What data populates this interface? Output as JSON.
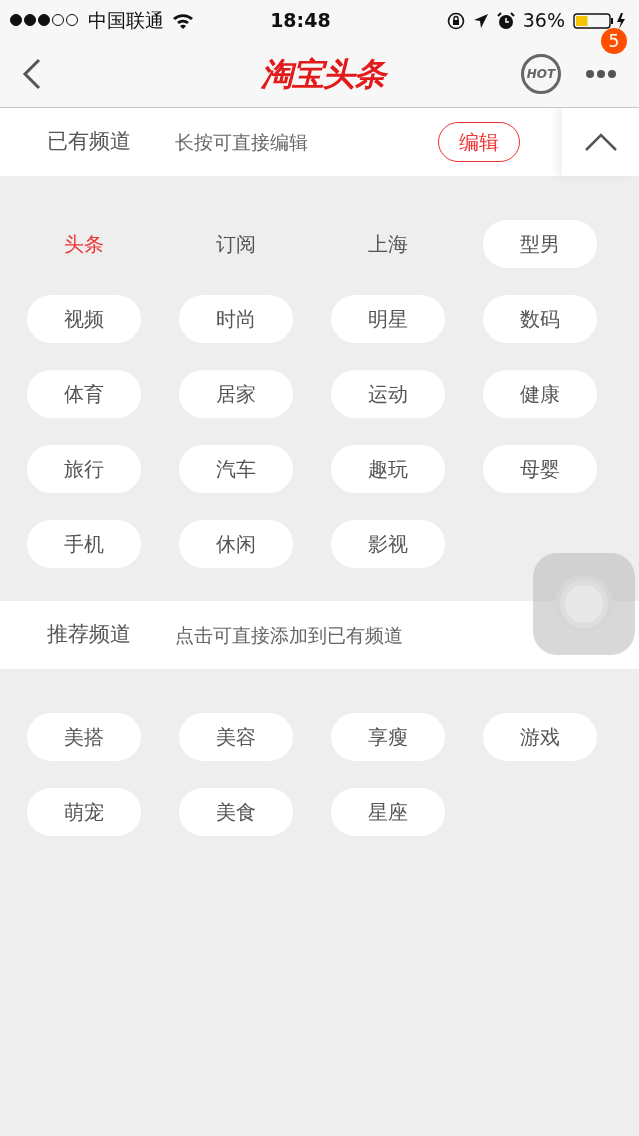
{
  "status_bar": {
    "carrier": "中国联通",
    "time": "18:48",
    "battery": "36%"
  },
  "nav": {
    "logo": "淘宝头条",
    "hot_label": "HOT",
    "badge": "5"
  },
  "my_channels": {
    "title": "已有频道",
    "hint": "长按可直接编辑",
    "edit_button": "编辑",
    "expanded": true,
    "items": [
      {
        "label": "头条",
        "fixed": true,
        "selected": true
      },
      {
        "label": "订阅",
        "fixed": true,
        "selected": false
      },
      {
        "label": "上海",
        "fixed": true,
        "selected": false
      },
      {
        "label": "型男",
        "fixed": false,
        "selected": false
      },
      {
        "label": "视频",
        "fixed": false,
        "selected": false
      },
      {
        "label": "时尚",
        "fixed": false,
        "selected": false
      },
      {
        "label": "明星",
        "fixed": false,
        "selected": false
      },
      {
        "label": "数码",
        "fixed": false,
        "selected": false
      },
      {
        "label": "体育",
        "fixed": false,
        "selected": false
      },
      {
        "label": "居家",
        "fixed": false,
        "selected": false
      },
      {
        "label": "运动",
        "fixed": false,
        "selected": false
      },
      {
        "label": "健康",
        "fixed": false,
        "selected": false
      },
      {
        "label": "旅行",
        "fixed": false,
        "selected": false
      },
      {
        "label": "汽车",
        "fixed": false,
        "selected": false
      },
      {
        "label": "趣玩",
        "fixed": false,
        "selected": false
      },
      {
        "label": "母婴",
        "fixed": false,
        "selected": false
      },
      {
        "label": "手机",
        "fixed": false,
        "selected": false
      },
      {
        "label": "休闲",
        "fixed": false,
        "selected": false
      },
      {
        "label": "影视",
        "fixed": false,
        "selected": false
      }
    ]
  },
  "recommended": {
    "title": "推荐频道",
    "hint": "点击可直接添加到已有频道",
    "items": [
      {
        "label": "美搭"
      },
      {
        "label": "美容"
      },
      {
        "label": "享瘦"
      },
      {
        "label": "游戏"
      },
      {
        "label": "萌宠"
      },
      {
        "label": "美食"
      },
      {
        "label": "星座"
      }
    ]
  }
}
